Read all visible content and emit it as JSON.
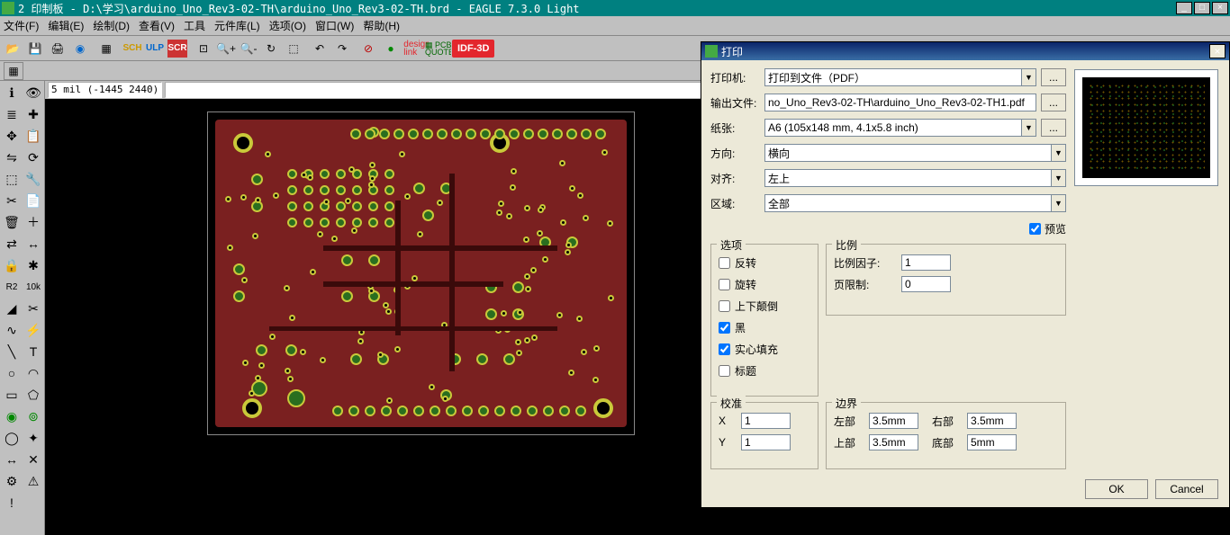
{
  "title": "2 印制板 - D:\\学习\\arduino_Uno_Rev3-02-TH\\arduino_Uno_Rev3-02-TH.brd - EAGLE 7.3.0 Light",
  "menu": [
    "文件(F)",
    "编辑(E)",
    "绘制(D)",
    "查看(V)",
    "工具",
    "元件库(L)",
    "选项(O)",
    "窗口(W)",
    "帮助(H)"
  ],
  "coord": "5 mil (-1445 2440)",
  "idf3d": "IDF-3D",
  "dialog": {
    "title": "打印",
    "labels": {
      "printer": "打印机:",
      "outfile": "输出文件:",
      "paper": "纸张:",
      "orient": "方向:",
      "align": "对齐:",
      "area": "区域:",
      "preview": "预览",
      "options": "选项",
      "scale": "比例",
      "cal": "校准",
      "border": "边界",
      "scale_factor": "比例因子:",
      "page_limit": "页限制:",
      "left": "左部",
      "right": "右部",
      "top": "上部",
      "bottom": "底部",
      "x": "X",
      "y": "Y"
    },
    "values": {
      "printer": "打印到文件（PDF）",
      "outfile": "no_Uno_Rev3-02-TH\\arduino_Uno_Rev3-02-TH1.pdf",
      "paper": "A6 (105x148 mm, 4.1x5.8 inch)",
      "orient": "横向",
      "align": "左上",
      "area": "全部",
      "scale_factor": "1",
      "page_limit": "0",
      "cal_x": "1",
      "cal_y": "1",
      "b_left": "3.5mm",
      "b_right": "3.5mm",
      "b_top": "3.5mm",
      "b_bottom": "5mm"
    },
    "opts": {
      "mirror": "反转",
      "rotate": "旋转",
      "upside": "上下颠倒",
      "black": "黑",
      "solid": "实心填充",
      "caption": "标题"
    },
    "buttons": {
      "ok": "OK",
      "cancel": "Cancel",
      "dots": "..."
    }
  }
}
